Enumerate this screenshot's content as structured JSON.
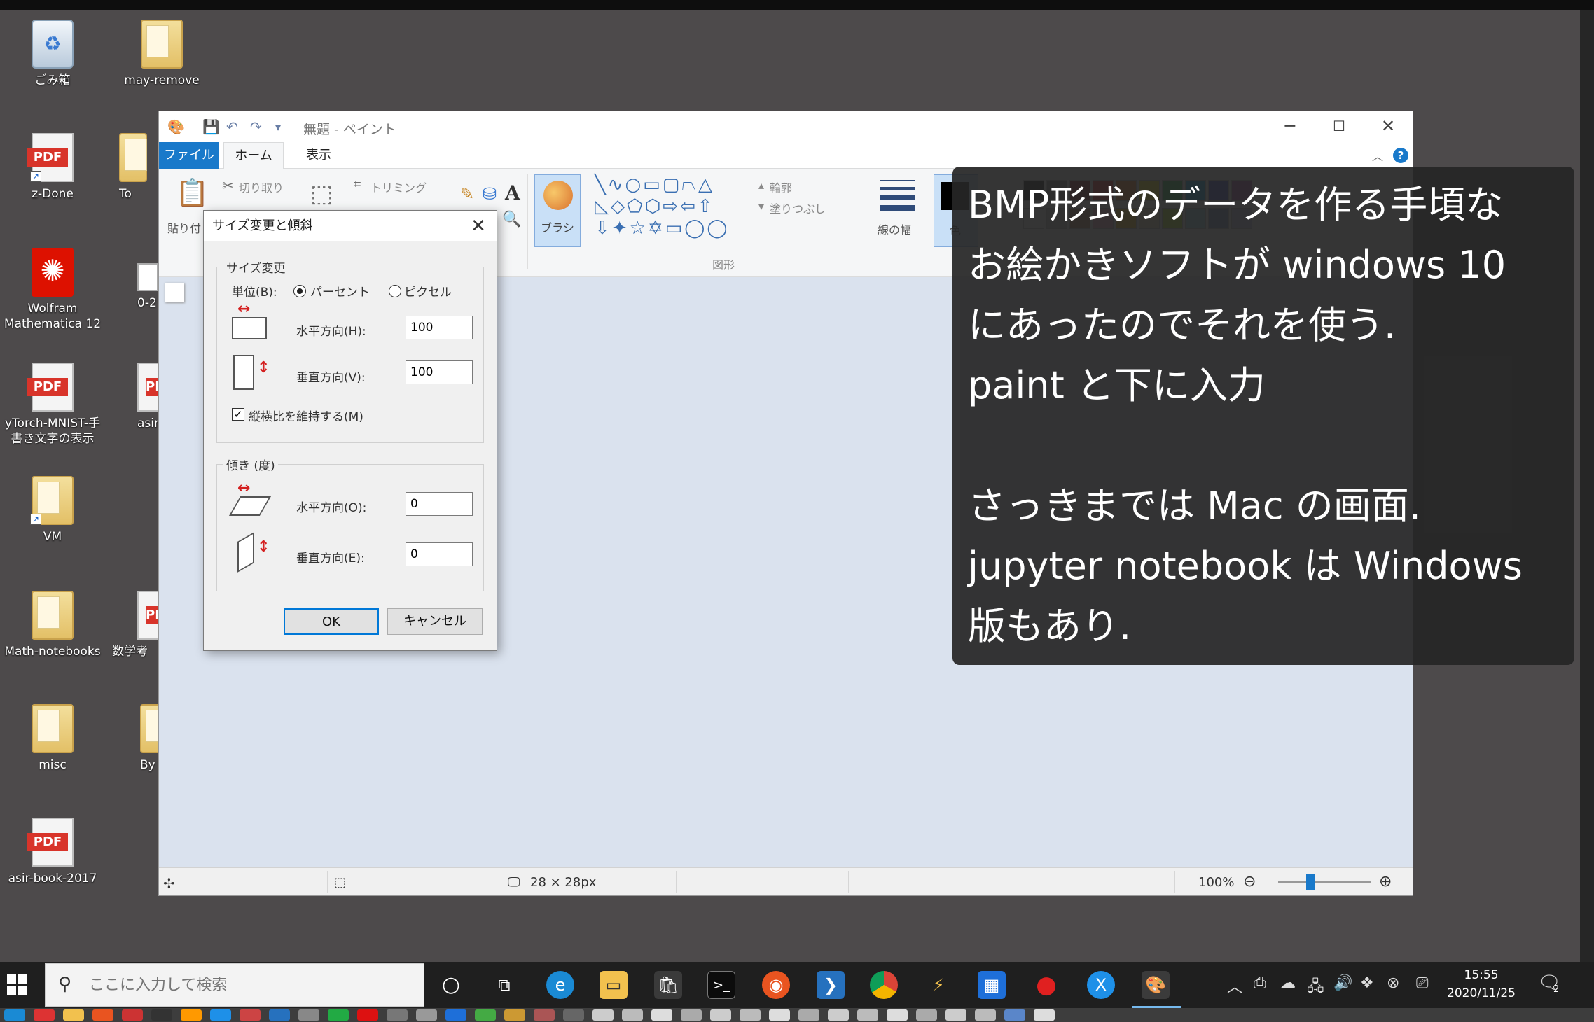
{
  "desktop": {
    "icons": [
      {
        "label": "ごみ箱",
        "kind": "bin"
      },
      {
        "label": "may-remove",
        "kind": "folder"
      },
      {
        "label": "z-Done",
        "kind": "pdf"
      },
      {
        "label": "To",
        "kind": "folder"
      },
      {
        "label": "Wolfram Mathematica 12",
        "kind": "wolfram"
      },
      {
        "label": "0-2",
        "kind": "file"
      },
      {
        "label": "yTorch-MNIST-手書き文字の表示",
        "kind": "pdf"
      },
      {
        "label": "asir-",
        "kind": "pdf"
      },
      {
        "label": "VM",
        "kind": "folder"
      },
      {
        "label": "Math-notebooks",
        "kind": "folder"
      },
      {
        "label": "数学考",
        "kind": "pdf"
      },
      {
        "label": "misc",
        "kind": "folder"
      },
      {
        "label": "By",
        "kind": "folder"
      },
      {
        "label": "asir-book-2017",
        "kind": "pdf"
      }
    ],
    "pdf_tag": "PDF"
  },
  "paint": {
    "window_title": "無題 - ペイント",
    "tabs": {
      "file": "ファイル",
      "home": "ホーム",
      "view": "表示"
    },
    "ribbon": {
      "paste": "貼り付",
      "cut": "切り取り",
      "crop": "トリミング",
      "brush": "ブラシ",
      "shapes_group": "図形",
      "outline": "輪郭",
      "fill": "塗りつぶし",
      "width": "線の幅",
      "color1": "色"
    },
    "status": {
      "size": "28 × 28px",
      "zoom": "100%"
    }
  },
  "dialog": {
    "title": "サイズ変更と傾斜",
    "resize_group": "サイズ変更",
    "unit_label": "単位(B):",
    "unit_percent": "パーセント",
    "unit_pixel": "ピクセル",
    "horizontal_label": "水平方向(H):",
    "horizontal_value": "100",
    "vertical_label": "垂直方向(V):",
    "vertical_value": "100",
    "keep_ratio": "縦横比を維持する(M)",
    "skew_group": "傾き (度)",
    "skew_h_label": "水平方向(O):",
    "skew_h_value": "0",
    "skew_v_label": "垂直方向(E):",
    "skew_v_value": "0",
    "ok": "OK",
    "cancel": "キャンセル"
  },
  "caption": {
    "lines": [
      "BMP形式のデータを作る手頃な",
      "お絵かきソフトが windows 10",
      "にあったのでそれを使う.",
      "paint と下に入力",
      "",
      "さっきまでは Mac の画面.",
      "jupyter notebook は Windows",
      "版もあり."
    ]
  },
  "taskbar": {
    "search_placeholder": "ここに入力して検索",
    "time": "15:55",
    "date": "2020/11/25",
    "notification_count": "2"
  },
  "colors": {
    "accent": "#1979ca",
    "desktop": "#4d4a4b",
    "canvas_bg": "#dae2ee"
  }
}
